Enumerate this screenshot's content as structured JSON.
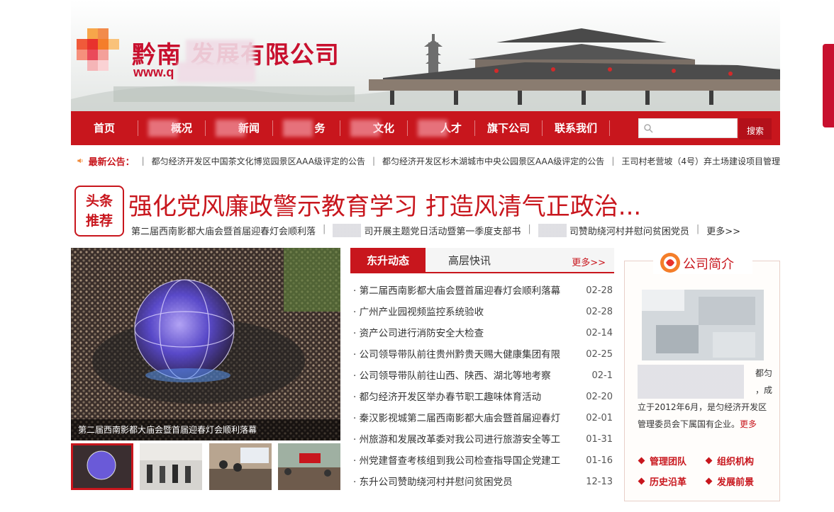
{
  "header": {
    "company_name": "黔南      发展有限公司",
    "company_url": "www.q"
  },
  "nav": {
    "items": [
      {
        "label": "首页"
      },
      {
        "label": "概况"
      },
      {
        "label": "新闻"
      },
      {
        "label": "务"
      },
      {
        "label": "文化"
      },
      {
        "label": "人才"
      },
      {
        "label": "旗下公司"
      },
      {
        "label": "联系我们"
      }
    ],
    "search_placeholder": "",
    "search_button": "搜索"
  },
  "notice": {
    "label": "最新公告：",
    "items": [
      "都匀经济开发区中国茶文化博览园景区AAA级评定的公告",
      "都匀经济开发区杉木湖城市中央公园景区AAA级评定的公告",
      "王司村老营坡（4号）弃土场建设项目管理"
    ]
  },
  "headline": {
    "badge_line1": "头条",
    "badge_line2": "推荐",
    "title": "强化党风廉政警示教育学习 打造风清气正政治...",
    "subs": [
      "第二届西南影都大庙会暨首届迎春灯会顺利落",
      "司开展主题党日活动暨第一季度支部书",
      "司赞助绕河村并慰问贫困党员"
    ],
    "more": "更多>>"
  },
  "slideshow": {
    "caption": "第二届西南影都大庙会暨首届迎春灯会顺利落幕"
  },
  "news": {
    "tabs": [
      "东升动态",
      "高层快讯"
    ],
    "more": "更多>>",
    "items": [
      {
        "title": "· 第二届西南影都大庙会暨首届迎春灯会顺利落幕",
        "date": "02-28"
      },
      {
        "title": "· 广州产业园视频监控系统验收",
        "date": "02-28"
      },
      {
        "title": "· 资产公司进行消防安全大检查",
        "date": "02-14"
      },
      {
        "title": "· 公司领导带队前往贵州黔贵天赐大健康集团有限",
        "date": "02-25"
      },
      {
        "title": "· 公司领导带队前往山西、陕西、湖北等地考察",
        "date": "02-1"
      },
      {
        "title": "· 都匀经济开发区举办春节职工趣味体育活动",
        "date": "02-20"
      },
      {
        "title": "· 秦汉影视城第二届西南影都大庙会暨首届迎春灯",
        "date": "02-01"
      },
      {
        "title": "· 州旅游和发展改革委对我公司进行旅游安全等工",
        "date": "01-31"
      },
      {
        "title": "· 州党建督查考核组到我公司检查指导国企党建工",
        "date": "01-16"
      },
      {
        "title": "· 东升公司赞助绕河村并慰问贫困党员",
        "date": "12-13"
      }
    ]
  },
  "intro": {
    "title": "公司简介",
    "text_line1": "都匀",
    "text_line2": "，成",
    "text_line3": "立于2012年6月，是匀经济开发区",
    "text_line4": "管理委员会下属国有企业。",
    "more": "更多",
    "links": [
      "管理团队",
      "组织机构",
      "历史沿革",
      "发展前景"
    ]
  },
  "colors": {
    "brand_red": "#c8161d"
  }
}
